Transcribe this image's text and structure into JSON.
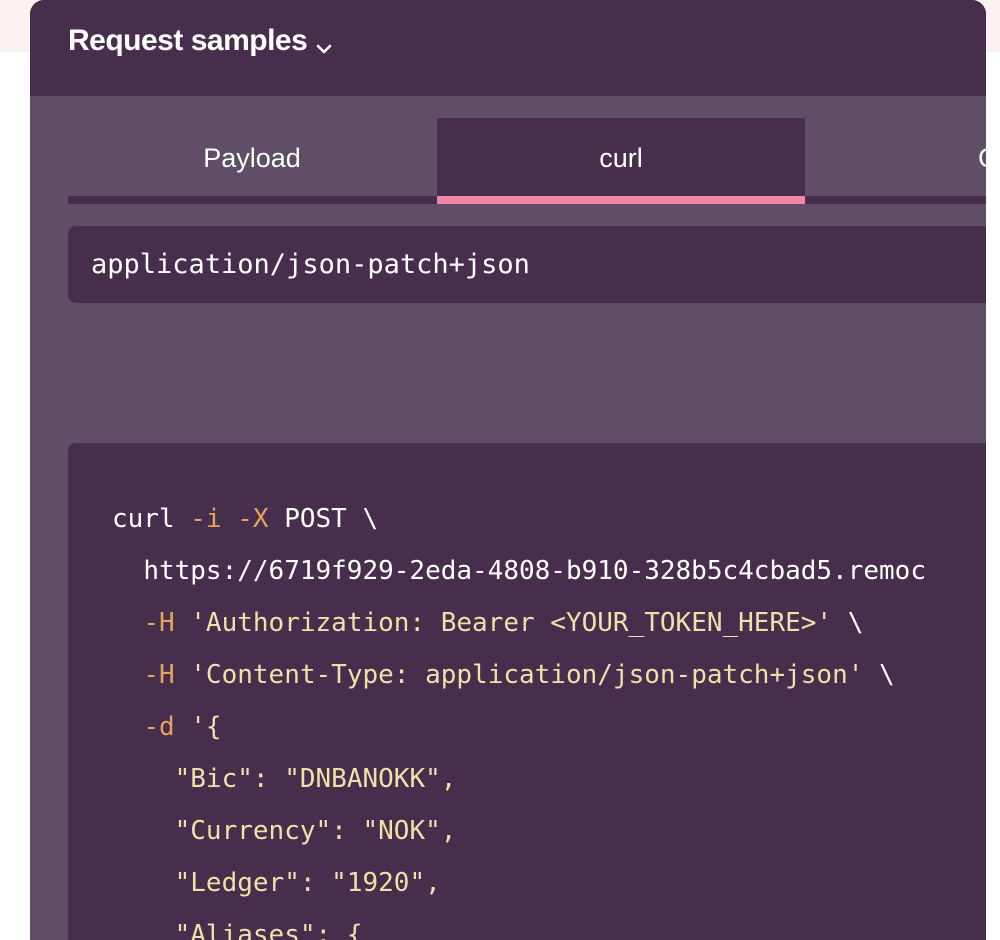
{
  "panel": {
    "title": "Request samples",
    "toggle_icon": "chevron-down-icon"
  },
  "tabs": [
    {
      "label": "Payload",
      "active": false
    },
    {
      "label": "curl",
      "active": true
    },
    {
      "label": "C",
      "active": false
    }
  ],
  "content_type": "application/json-patch+json",
  "colors": {
    "header_bg": "#472e4c",
    "panel_bg": "#604e68",
    "accent": "#ee87a4",
    "flag": "#e5a35b",
    "string": "#f3dfa7"
  },
  "code": {
    "l1": {
      "cmd": "curl ",
      "flag1": "-i",
      "flag2": "-X",
      "rest": " POST \\"
    },
    "l2": {
      "url": "https://6719f929-2eda-4808-b910-328b5c4cbad5.remoc"
    },
    "l3": {
      "flag": "-H",
      "str": "'Authorization: Bearer <YOUR_TOKEN_HERE>'",
      "rest": " \\"
    },
    "l4": {
      "flag": "-H",
      "str": "'Content-Type: application/json-patch+json'",
      "rest": " \\"
    },
    "l5": {
      "flag": "-d",
      "str": "'{"
    },
    "l6": {
      "key": "\"Bic\"",
      "sep": ": ",
      "value": "\"DNBANOKK\"",
      "end": ","
    },
    "l7": {
      "key": "\"Currency\"",
      "sep": ": ",
      "value": "\"NOK\"",
      "end": ","
    },
    "l8": {
      "key": "\"Ledger\"",
      "sep": ": ",
      "value": "\"1920\"",
      "end": ","
    },
    "l9": {
      "key": "\"Aliases\"",
      "sep": ": ",
      "value": "{"
    }
  }
}
